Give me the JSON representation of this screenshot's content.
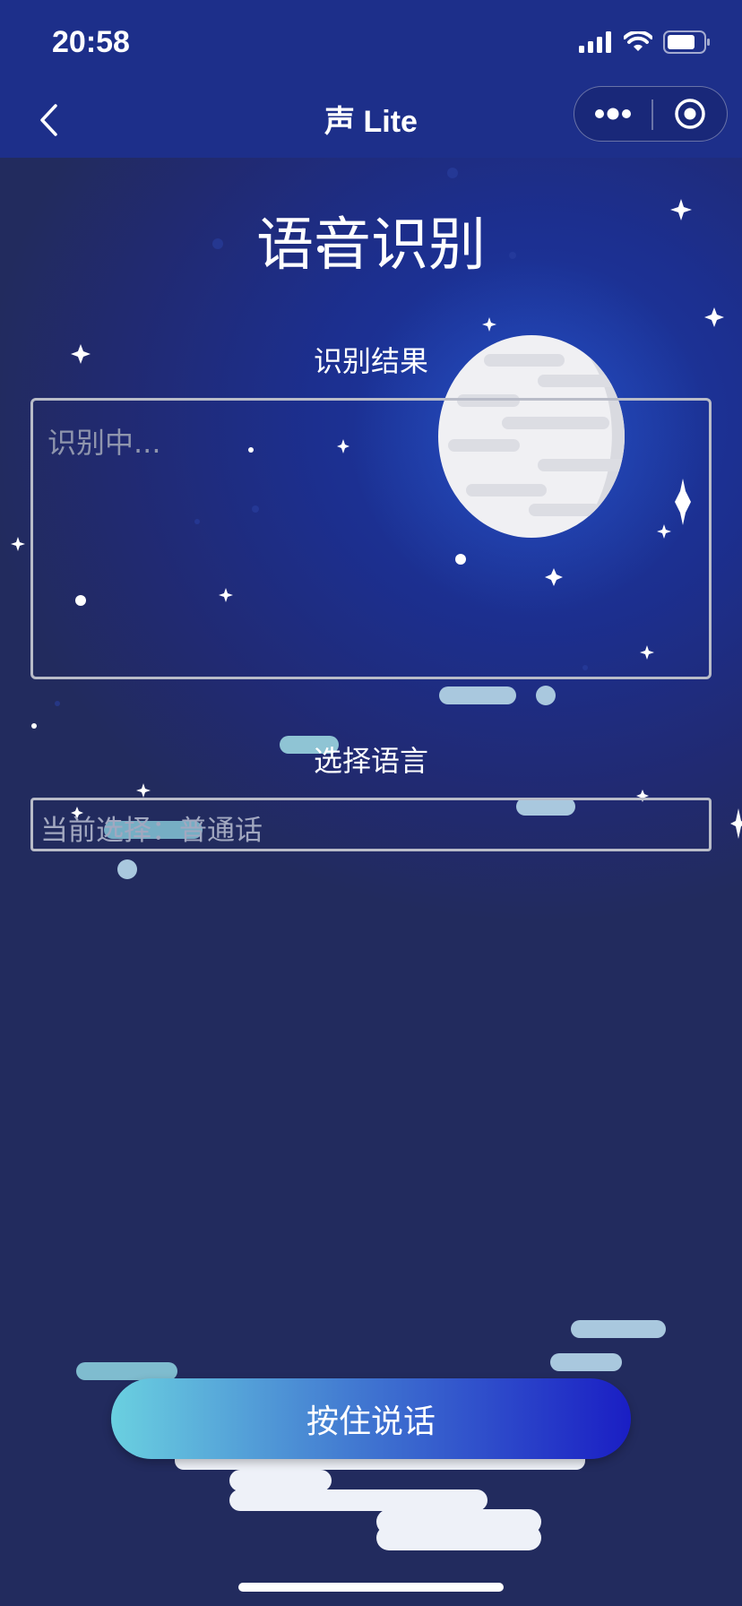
{
  "status_bar": {
    "time": "20:58",
    "icons": [
      "signal-icon",
      "wifi-icon",
      "battery-icon"
    ]
  },
  "nav": {
    "title": "声 Lite",
    "back_icon": "chevron-left-icon",
    "more_icon": "more-dots-icon",
    "close_icon": "target-close-icon"
  },
  "page": {
    "title": "语音识别",
    "result_label": "识别结果",
    "result_placeholder": "识别中...",
    "language_label": "选择语言",
    "language_value": "当前选择：普通话"
  },
  "talk_button": {
    "label": "按住说话"
  },
  "colors": {
    "bg_top": "#1d2f8a",
    "bg_bottom": "#222b5e",
    "button_start": "#6ad0e0",
    "button_end": "#1a1ec4",
    "moon": "#f0f0f2",
    "cloud": "#a9c8de"
  }
}
